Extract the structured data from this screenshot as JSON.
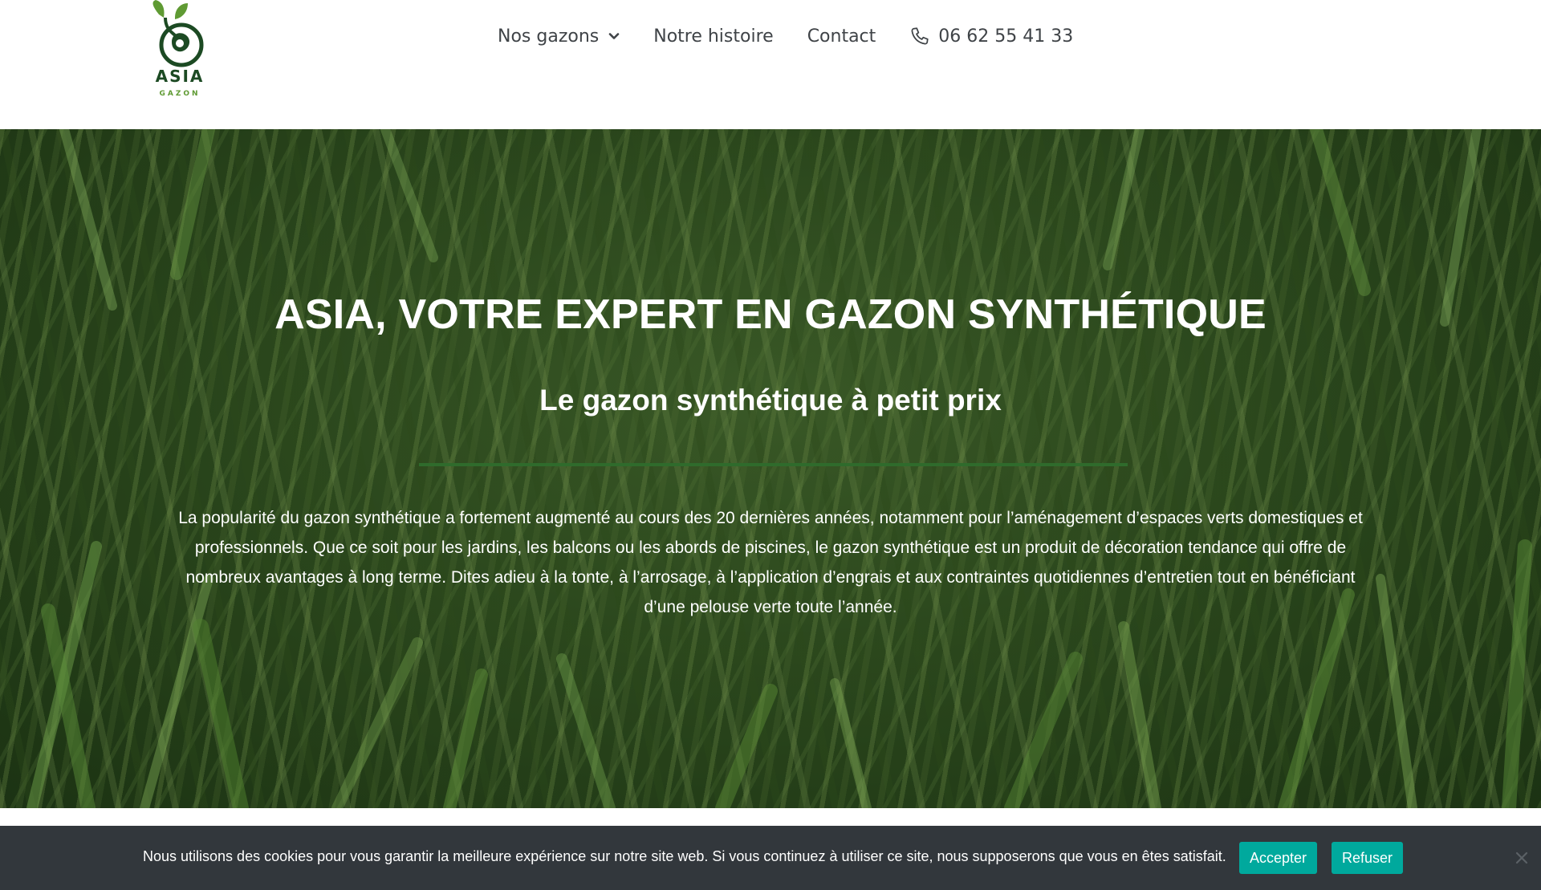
{
  "brand": {
    "name": "ASIA",
    "tagline": "GAZON",
    "colors": {
      "dark_green": "#1c4a23",
      "leaf_green": "#5f9a33",
      "divider_green": "#2f6b2c"
    }
  },
  "nav": {
    "items": [
      {
        "label": "Nos gazons",
        "has_dropdown": true,
        "icon": "chevron-down-icon"
      },
      {
        "label": "Notre histoire"
      },
      {
        "label": "Contact"
      }
    ],
    "phone": {
      "icon": "phone-icon",
      "label": "06 62 55 41 33"
    }
  },
  "hero": {
    "title": "ASIA, VOTRE EXPERT EN GAZON SYNTHÉTIQUE",
    "subtitle": "Le gazon synthétique à petit prix",
    "body": "La popularité du gazon synthétique a fortement augmenté au cours des 20 dernières années, notamment pour l’aménagement d’espaces verts domestiques et professionnels. Que ce soit pour les jardins, les balcons ou les abords de piscines, le gazon synthétique est un produit de décoration tendance qui offre de nombreux avantages à long terme. Dites adieu à la tonte, à l’arrosage, à l’application d’engrais et aux contraintes quotidiennes d’entretien tout en bénéficiant d’une pelouse verte toute l’année."
  },
  "cookie": {
    "message": "Nous utilisons des cookies pour vous garantir la meilleure expérience sur notre site web. Si vous continuez à utiliser ce site, nous supposerons que vous en êtes satisfait.",
    "accept_label": "Accepter",
    "refuse_label": "Refuser",
    "button_color": "#00a99d",
    "bar_color": "#32373c",
    "close_icon": "close-icon"
  }
}
